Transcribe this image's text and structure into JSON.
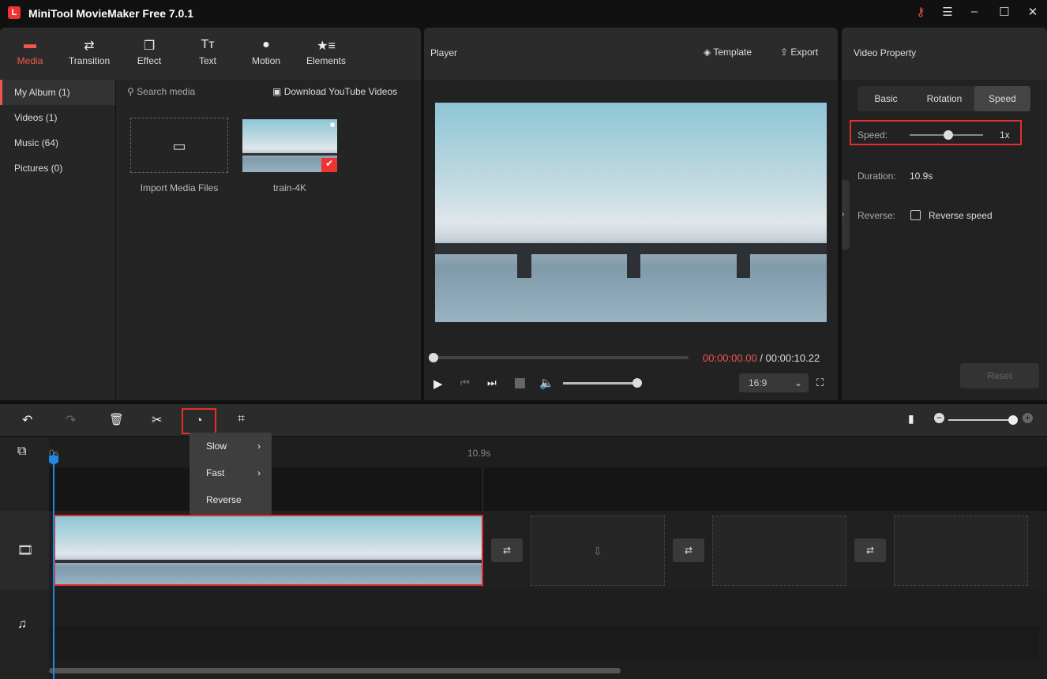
{
  "app": {
    "title": "MiniTool MovieMaker Free 7.0.1"
  },
  "tabs": [
    {
      "label": "Media",
      "icon": "folder-icon",
      "active": true
    },
    {
      "label": "Transition",
      "icon": "swap-icon"
    },
    {
      "label": "Effect",
      "icon": "layers-icon"
    },
    {
      "label": "Text",
      "icon": "text-icon"
    },
    {
      "label": "Motion",
      "icon": "motion-icon"
    },
    {
      "label": "Elements",
      "icon": "elements-icon"
    }
  ],
  "sidebar": {
    "items": [
      {
        "label": "My Album (1)",
        "active": true
      },
      {
        "label": "Videos (1)"
      },
      {
        "label": "Music (64)"
      },
      {
        "label": "Pictures (0)"
      }
    ]
  },
  "media": {
    "search_placeholder": "Search media",
    "download_label": "Download YouTube Videos",
    "import_label": "Import Media Files",
    "clip_name": "train-4K"
  },
  "player": {
    "title": "Player",
    "template_label": "Template",
    "export_label": "Export",
    "current_time": "00:00:00.00",
    "total_time": "/ 00:00:10.22",
    "aspect": "16:9",
    "progress": 0,
    "volume": 1.0
  },
  "property": {
    "title": "Video Property",
    "tabs": [
      "Basic",
      "Rotation",
      "Speed"
    ],
    "active_tab": "Speed",
    "speed_label": "Speed:",
    "speed_value": "1x",
    "duration_label": "Duration:",
    "duration_value": "10.9s",
    "reverse_label": "Reverse:",
    "reverse_checkbox": "Reverse speed",
    "reverse_checked": false,
    "reset_label": "Reset"
  },
  "timeline": {
    "ruler_start": "0s",
    "ruler_mark": "10.9s",
    "speed_menu": [
      {
        "label": "Slow",
        "submenu": true
      },
      {
        "label": "Fast",
        "submenu": true
      },
      {
        "label": "Reverse",
        "submenu": false
      }
    ]
  },
  "colors": {
    "accent": "#f0574a",
    "playhead": "#1e88e5",
    "highlight": "#e52d2d"
  }
}
